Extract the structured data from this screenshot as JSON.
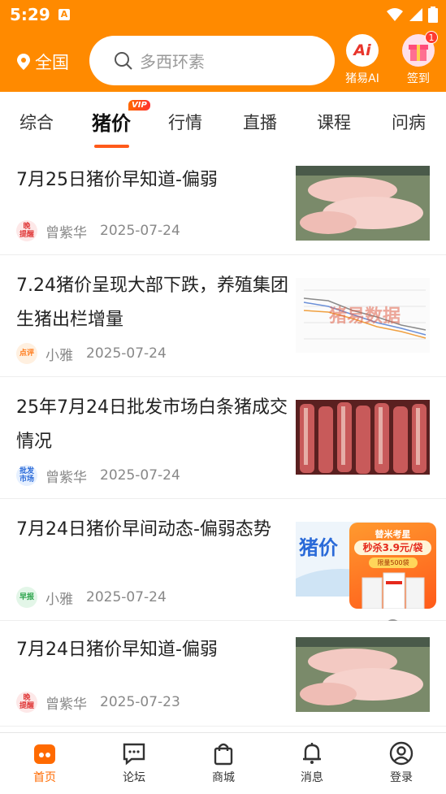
{
  "status_bar": {
    "time": "5:29",
    "notif_letter": "A"
  },
  "header": {
    "location": "全国",
    "search_placeholder": "多西环素",
    "ai_label": "猪易AI",
    "ai_icon_text": "Ai",
    "signin_label": "签到",
    "signin_badge": "1"
  },
  "tabs": [
    {
      "label": "综合"
    },
    {
      "label": "猪价",
      "active": true,
      "badge": "VIP"
    },
    {
      "label": "行情"
    },
    {
      "label": "直播"
    },
    {
      "label": "课程"
    },
    {
      "label": "问病"
    }
  ],
  "articles": [
    {
      "title": "7月25日猪价早知道-偏弱",
      "badge": "晚\n提醒",
      "author": "曾紫华",
      "date": "2025-07-24",
      "thumb": "pigs-photo"
    },
    {
      "title": "7.24猪价呈现大部下跌，养殖集团生猪出栏增量",
      "badge": "点评",
      "author": "小雅",
      "date": "2025-07-24",
      "thumb": "price-chart"
    },
    {
      "title": "25年7月24日批发市场白条猪成交情况",
      "badge": "批发\n市场",
      "author": "曾紫华",
      "date": "2025-07-24",
      "thumb": "pork-carcass-photo"
    },
    {
      "title": "7月24日猪价早间动态-偏弱态势",
      "badge": "早报",
      "author": "小雅",
      "date": "2025-07-24",
      "thumb": "pig-price-banner"
    },
    {
      "title": "7月24日猪价早知道-偏弱",
      "badge": "晚\n提醒",
      "author": "曾紫华",
      "date": "2025-07-23",
      "thumb": "pigs-photo"
    }
  ],
  "chart_thumb_watermark": "猪易数据",
  "banner_thumb_text": "猪价",
  "ad": {
    "line1": "替米考星",
    "line2": "秒杀3.9元/袋",
    "line3": "限量500袋"
  },
  "bottom_nav": [
    {
      "label": "首页",
      "active": true
    },
    {
      "label": "论坛"
    },
    {
      "label": "商城"
    },
    {
      "label": "消息"
    },
    {
      "label": "登录"
    }
  ]
}
